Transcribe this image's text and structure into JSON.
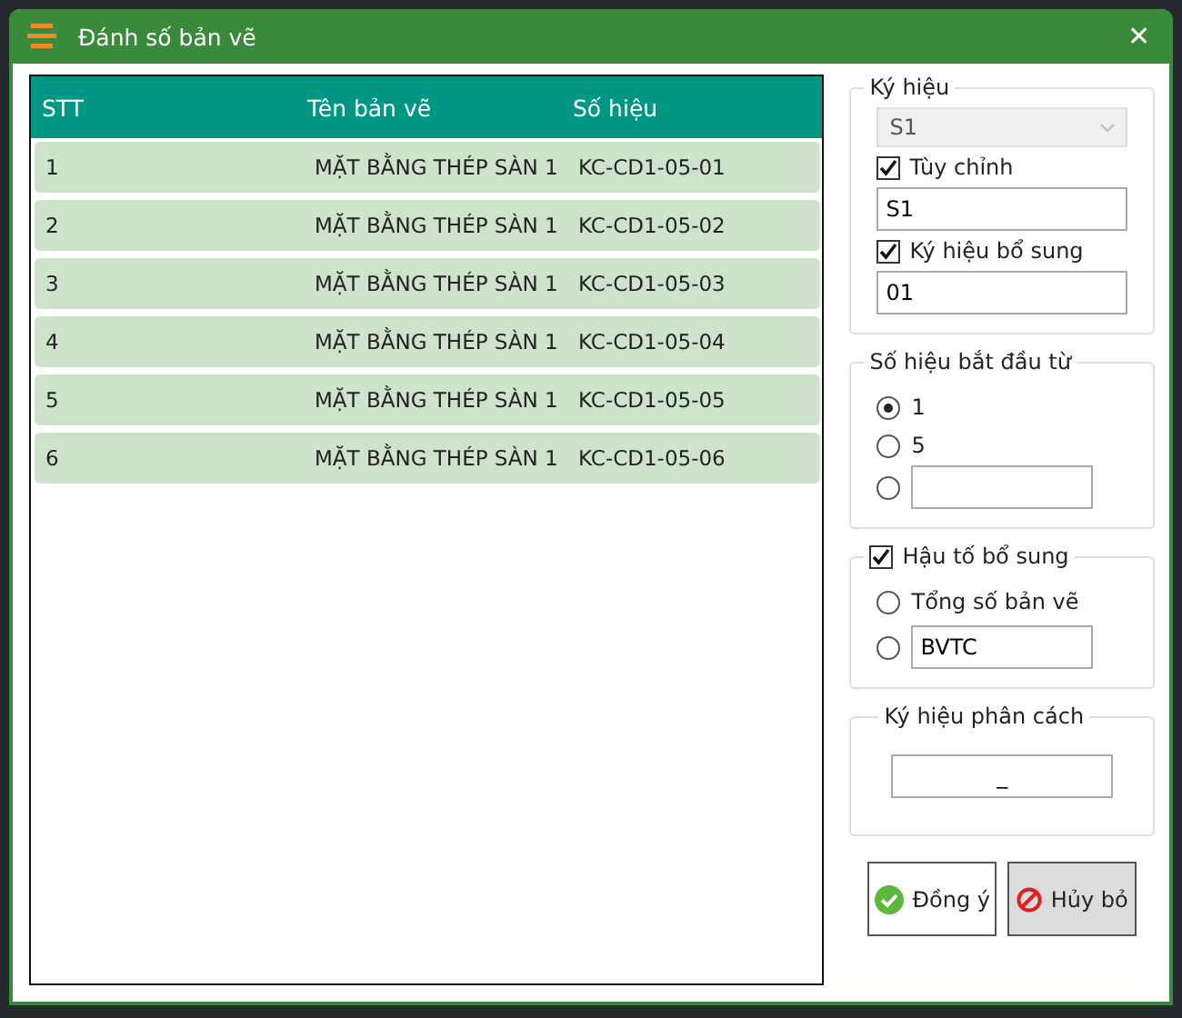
{
  "window": {
    "title": "Đánh số bản vẽ",
    "close": "✕"
  },
  "table": {
    "columns": [
      "STT",
      "Tên bản vẽ",
      "Số hiệu"
    ],
    "rows": [
      {
        "stt": "1",
        "name": "MẶT BẰNG THÉP SÀN 1",
        "code": "KC-CD1-05-01"
      },
      {
        "stt": "2",
        "name": "MẶT BẰNG THÉP SÀN 1",
        "code": "KC-CD1-05-02"
      },
      {
        "stt": "3",
        "name": "MẶT BẰNG THÉP SÀN 1",
        "code": "KC-CD1-05-03"
      },
      {
        "stt": "4",
        "name": "MẶT BẰNG THÉP SÀN 1",
        "code": "KC-CD1-05-04"
      },
      {
        "stt": "5",
        "name": "MẶT BẰNG THÉP SÀN 1",
        "code": "KC-CD1-05-05"
      },
      {
        "stt": "6",
        "name": "MẶT BẰNG THÉP SÀN 1",
        "code": "KC-CD1-05-06"
      }
    ]
  },
  "symbol_group": {
    "legend": "Ký hiệu",
    "dropdown": {
      "value": "S1",
      "disabled": true
    },
    "custom": {
      "label": "Tùy chỉnh",
      "checked": true,
      "value": "S1"
    },
    "supplement": {
      "label": "Ký hiệu bổ sung",
      "checked": true,
      "value": "01"
    }
  },
  "start_group": {
    "legend": "Số hiệu bắt đầu từ",
    "options": [
      {
        "kind": "label",
        "label": "1",
        "selected": true
      },
      {
        "kind": "label",
        "label": "5",
        "selected": false
      },
      {
        "kind": "field",
        "selected": false
      }
    ]
  },
  "suffix_group": {
    "legend": "Hậu tố bổ sung",
    "checked": true,
    "options": [
      {
        "kind": "label",
        "label": "Tổng số bản vẽ",
        "selected": false
      },
      {
        "kind": "field",
        "value": "BVTC",
        "selected": false
      }
    ]
  },
  "separator_group": {
    "legend": "Ký hiệu phân cách",
    "value": "_"
  },
  "buttons": [
    {
      "kind": "ok",
      "label": "Đồng ý"
    },
    {
      "kind": "cancel",
      "label": "Hủy bỏ"
    }
  ]
}
